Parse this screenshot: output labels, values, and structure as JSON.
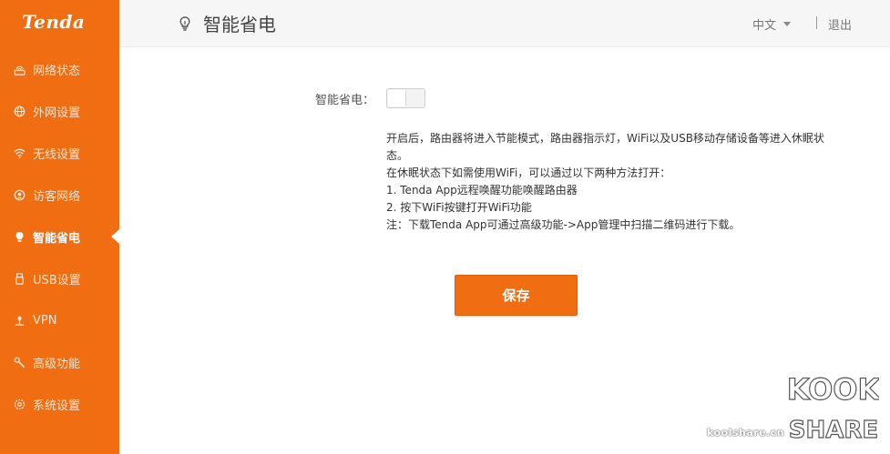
{
  "brand": {
    "logo_text": "Tenda",
    "color": "#f06d12"
  },
  "sidebar": {
    "items": [
      {
        "label": "网络状态",
        "icon": "network-status-icon",
        "active": false
      },
      {
        "label": "外网设置",
        "icon": "globe-icon",
        "active": false
      },
      {
        "label": "无线设置",
        "icon": "wifi-icon",
        "active": false
      },
      {
        "label": "访客网络",
        "icon": "guest-network-icon",
        "active": false
      },
      {
        "label": "智能省电",
        "icon": "lightbulb-icon",
        "active": true
      },
      {
        "label": "USB设置",
        "icon": "usb-icon",
        "active": false
      },
      {
        "label": "VPN",
        "icon": "vpn-icon",
        "active": false
      },
      {
        "label": "高级功能",
        "icon": "wrench-icon",
        "active": false
      },
      {
        "label": "系统设置",
        "icon": "gear-icon",
        "active": false
      }
    ]
  },
  "header": {
    "title": "智能省电",
    "title_icon": "lightbulb-icon",
    "language": "中文",
    "logout": "退出"
  },
  "main": {
    "toggle_label": "智能省电：",
    "toggle_on": false,
    "description": [
      "开启后，路由器将进入节能模式，路由器指示灯，WiFi以及USB移动存储设备等进入休眠状",
      "态。",
      "在休眠状态下如需使用WiFi，可以通过以下两种方法打开：",
      "1. Tenda App远程唤醒功能唤醒路由器",
      "2. 按下WiFi按键打开WiFi功能",
      "注：下载Tenda App可通过高级功能->App管理中扫描二维码进行下载。"
    ],
    "save_label": "保存"
  },
  "watermark": {
    "site": "koolshare.cn",
    "logo_top": "KOOK",
    "logo_bottom": "SHARE"
  }
}
